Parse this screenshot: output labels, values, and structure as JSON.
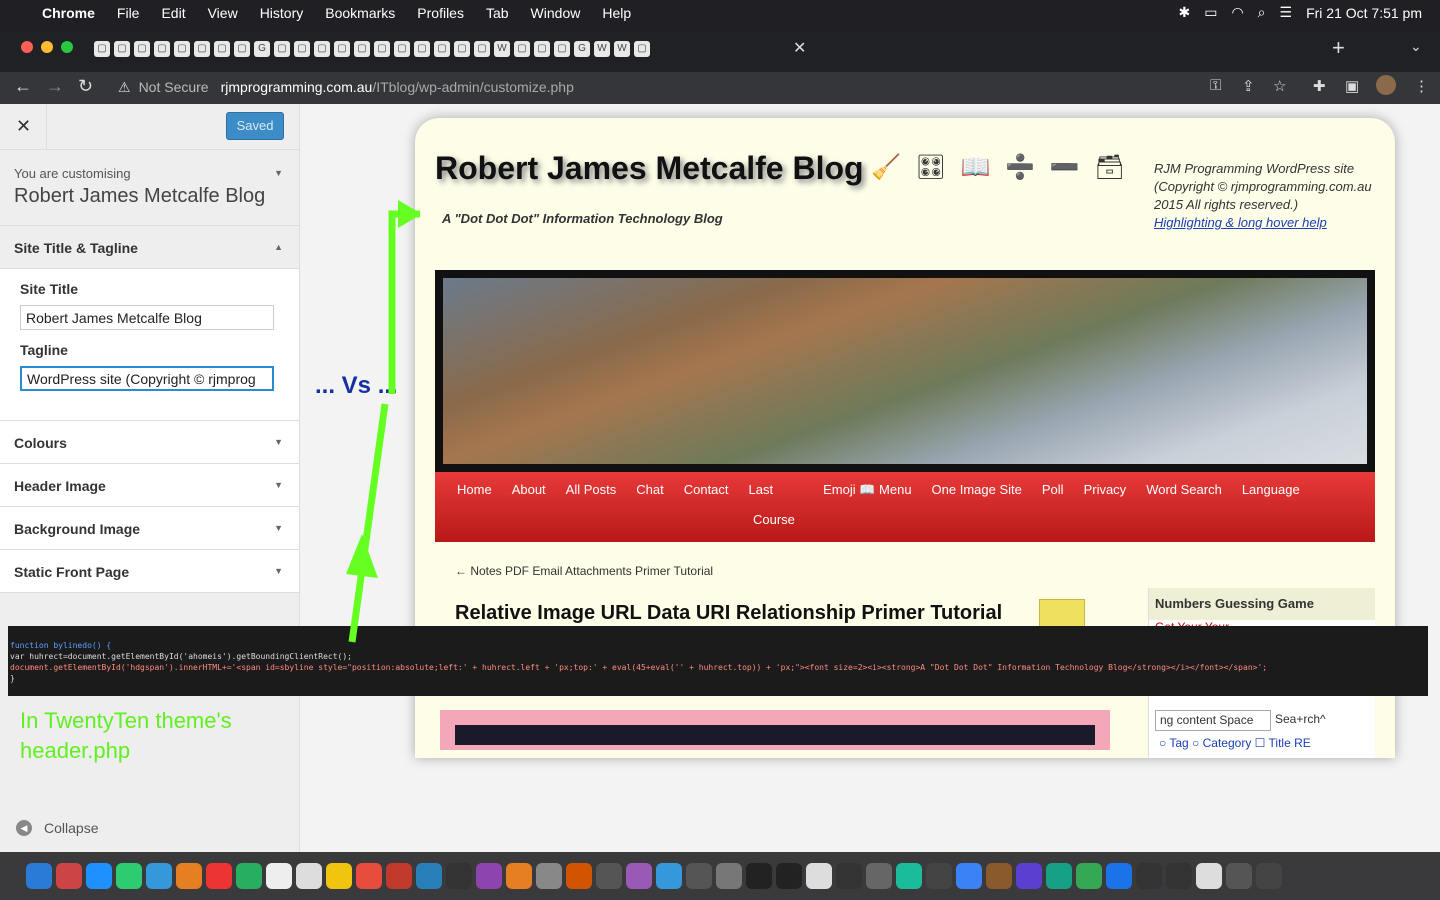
{
  "menubar": {
    "app": "Chrome",
    "items": [
      "File",
      "Edit",
      "View",
      "History",
      "Bookmarks",
      "Profiles",
      "Tab",
      "Window",
      "Help"
    ],
    "clock": "Fri 21 Oct  7:51 pm"
  },
  "browser": {
    "security_label": "Not Secure",
    "url_host": "rjmprogramming.com.au",
    "url_path": "/ITblog/wp-admin/customize.php"
  },
  "customizer": {
    "saved_label": "Saved",
    "customising_label": "You are customising",
    "site_name": "Robert James Metcalfe Blog",
    "sections": {
      "site_title_tagline": "Site Title & Tagline",
      "colours": "Colours",
      "header_image": "Header Image",
      "background_image": "Background Image",
      "static_front_page": "Static Front Page"
    },
    "site_title_label": "Site Title",
    "site_title_value": "Robert James Metcalfe Blog",
    "tagline_label": "Tagline",
    "tagline_value": "WordPress site (Copyright © rjmprog",
    "collapse_label": "Collapse"
  },
  "preview": {
    "site_title": "Robert James Metcalfe Blog",
    "tagline": "A \"Dot Dot Dot\" Information Technology Blog",
    "header_right_text": "RJM Programming WordPress site (Copyright © rjmprogramming.com.au 2015 All rights reserved.)",
    "header_right_link": "Highlighting & long hover help",
    "nav": [
      "Home",
      "About",
      "All Posts",
      "Chat",
      "Contact",
      "Last",
      "Emoji 📖 Menu",
      "One Image Site",
      "Poll",
      "Privacy",
      "Word Search",
      "Language",
      "Course"
    ],
    "prev_post": "← Notes PDF Email Attachments Primer Tutorial",
    "post_title": "Relative Image URL Data URI Relationship Primer Tutorial",
    "widget_title": "Numbers Guessing Game",
    "widget_text": "Get        Your        Your",
    "search_value": "ng content  Space",
    "search_label": "Sea+rch^",
    "search_options": "○ Tag  ○ Category  ☐ Title RE"
  },
  "annotation": {
    "vs": "... Vs ...",
    "note": "In TwentyTen theme's header.php"
  },
  "code": {
    "line1": "function bylinedo() {",
    "line2": "var huhrect=document.getElementById('ahomeis').getBoundingClientRect();",
    "line3": "document.getElementById('hdgspan').innerHTML+='<span id=sbyline style=\"position:absolute;left:' + huhrect.left + 'px;top:' + eval(45+eval('' + huhrect.top)) + 'px;\"><font size=2><i><strong>A \"Dot Dot Dot\" Information Technology Blog</strong></i></font></span>';",
    "line4": "}"
  },
  "colors": {
    "accent": "#3b8cc7",
    "nav_red": "#d42828",
    "annotation_green": "#66ff22",
    "vs_blue": "#1530a0"
  }
}
